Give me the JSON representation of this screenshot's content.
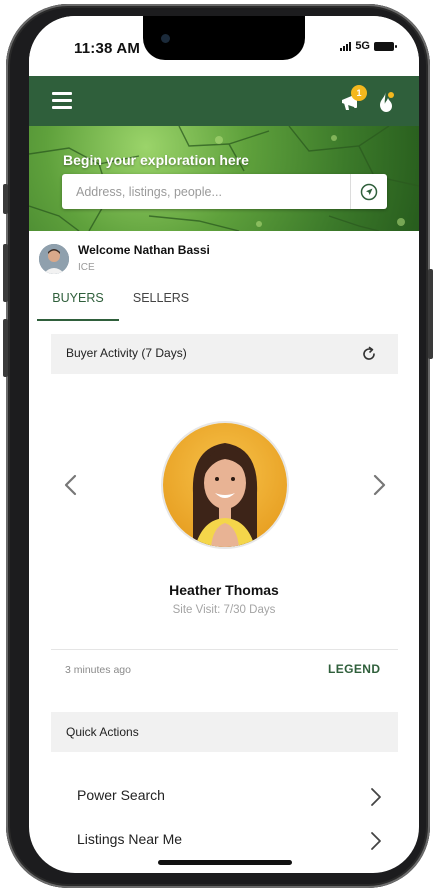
{
  "status_bar": {
    "time": "11:38 AM",
    "network": "5G"
  },
  "app_bar": {
    "notification_count": "1",
    "accent_color": "#2f5f3b",
    "badge_color": "#f4b81e"
  },
  "hero": {
    "title": "Begin your exploration here",
    "search_placeholder": "Address, listings, people..."
  },
  "welcome": {
    "title": "Welcome Nathan Bassi",
    "subtitle": "ICE"
  },
  "tabs": [
    {
      "label": "BUYERS",
      "active": true
    },
    {
      "label": "SELLERS",
      "active": false
    }
  ],
  "buyer_activity": {
    "title": "Buyer Activity (7 Days)",
    "person_name": "Heather Thomas",
    "site_visit": "Site Visit: 7/30 Days",
    "updated": "3 minutes ago",
    "legend_label": "LEGEND"
  },
  "quick_actions": {
    "title": "Quick Actions",
    "items": [
      {
        "label": "Power Search"
      },
      {
        "label": "Listings Near Me"
      }
    ]
  }
}
